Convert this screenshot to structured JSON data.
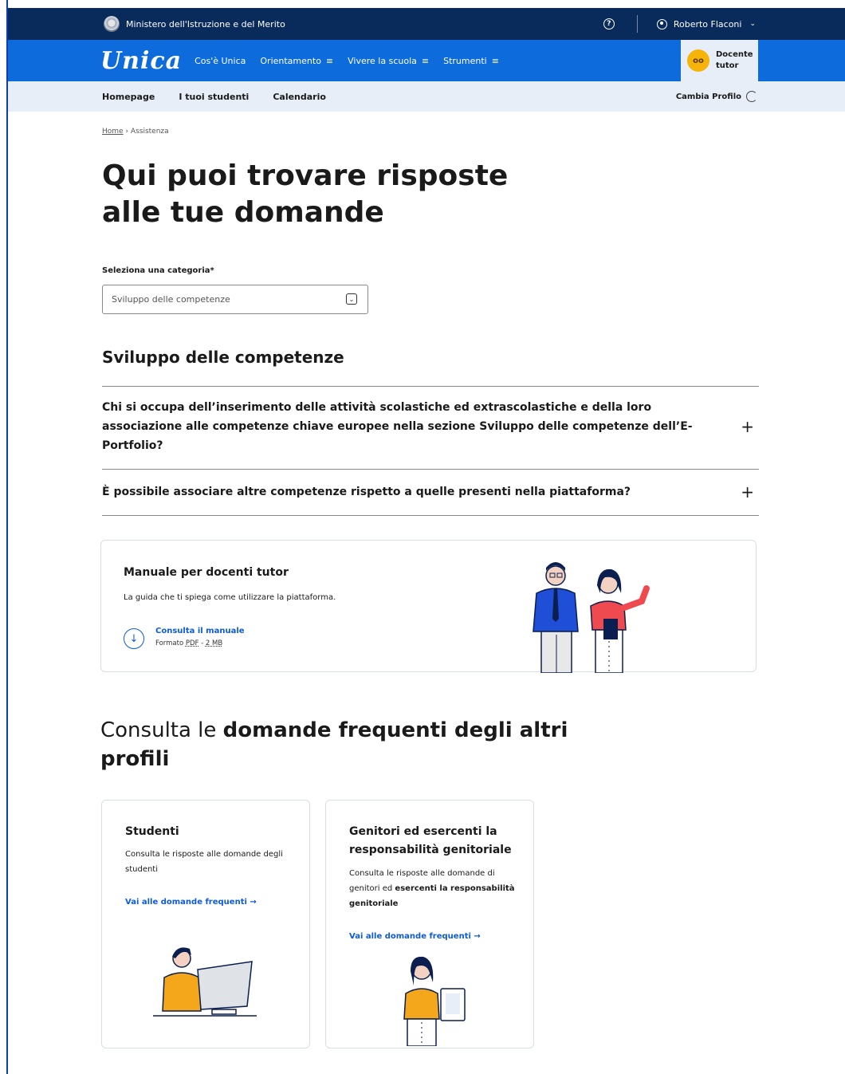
{
  "topbar": {
    "ministry": "Ministero dell'Istruzione e del Merito",
    "user_name": "Roberto Flaconi"
  },
  "mainnav": {
    "logo": "Unica",
    "links": [
      {
        "label": "Cos'è Unica"
      },
      {
        "label": "Orientamento"
      },
      {
        "label": "Vivere la scuola"
      },
      {
        "label": "Strumenti"
      }
    ],
    "profile": {
      "line1": "Docente",
      "line2": "tutor"
    }
  },
  "subnav": {
    "items": [
      "Homepage",
      "I tuoi studenti",
      "Calendario"
    ],
    "change_profile": "Cambia Profilo"
  },
  "breadcrumb": {
    "home": "Home",
    "current": "Assistenza"
  },
  "hero": {
    "line1": "Qui puoi trovare risposte",
    "line2": "alle tue domande"
  },
  "category": {
    "label": "Seleziona una categoria*",
    "value": "Sviluppo delle competenze"
  },
  "section_title": "Sviluppo delle competenze",
  "faqs": [
    {
      "question": "Chi si occupa dell’inserimento delle attività scolastiche ed extrascolastiche e della loro associazione alle competenze chiave europee nella sezione Sviluppo delle competenze dell’E-Portfolio?"
    },
    {
      "question": "È possibile associare altre competenze rispetto a quelle presenti nella piattaforma?"
    }
  ],
  "manual": {
    "title": "Manuale per docenti tutor",
    "description": "La guida che ti spiega come utilizzare la piattaforma.",
    "link": "Consulta il manuale",
    "format_prefix": "Formato",
    "format": "PDF",
    "size": "2 MB"
  },
  "other_profiles": {
    "title_pre": "Consulta le",
    "title_bold": "domande frequenti degli altri profili",
    "cards": [
      {
        "title": "Studenti",
        "description": "Consulta le risposte alle domande degli studenti",
        "link": "Vai alle domande frequenti"
      },
      {
        "title": "Genitori ed esercenti la responsabilità genitoriale",
        "description_pre": "Consulta le risposte alle domande di genitori ed",
        "description_bold": "esercenti la responsabilità genitoriale",
        "link": "Vai alle domande frequenti"
      }
    ]
  },
  "colors": {
    "topbar": "#082b5c",
    "nav": "#0d6bdc",
    "subnav": "#e7eef8",
    "link": "#0d5bd6",
    "accent_yellow": "#f6b40a"
  }
}
